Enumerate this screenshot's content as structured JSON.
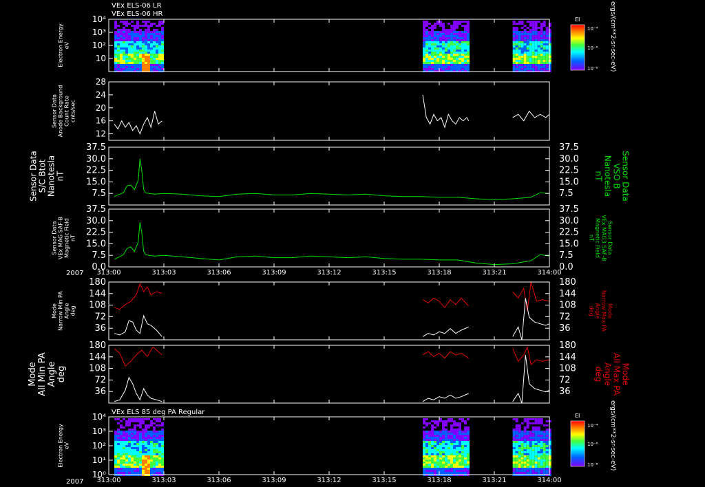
{
  "header": {
    "line1": "VEx ELS-06 LR",
    "line2": "VEx ELS-06 HR"
  },
  "year_label": "2007",
  "time_axis": {
    "ticks": [
      "313:00",
      "313:03",
      "313:06",
      "313:09",
      "313:12",
      "313:15",
      "313:18",
      "313:21",
      "314:00"
    ]
  },
  "colorbar": {
    "title": "EI",
    "units": "ergs/(cm**2-sr-sec-eV)",
    "tick_labels": [
      "10⁻⁴",
      "10⁻⁶",
      "10⁻⁸"
    ]
  },
  "colors": {
    "white": "#ffffff",
    "green": "#00e000",
    "red": "#e00000",
    "background": "#000000"
  },
  "chart_data": [
    {
      "type": "heatmap",
      "id": "panel1",
      "ylabel": [
        "Electron Energy",
        "eV"
      ],
      "y_log": true,
      "ylim": [
        1,
        10000
      ],
      "yticks": [
        "10⁴",
        "10³",
        "10²",
        "10"
      ],
      "data_intervals": [
        [
          "313:00.3",
          "313:02.9"
        ],
        [
          "313:17.1",
          "313:19.6"
        ],
        [
          "313:22.0",
          "313:24.0"
        ]
      ],
      "colorbar": true
    },
    {
      "type": "line",
      "id": "panel2",
      "ylabel": [
        "Sensor Data",
        "Anode Background",
        "Count Rate",
        "cnts/sec"
      ],
      "ylim": [
        10,
        28
      ],
      "yticks": [
        "28",
        "24",
        "20",
        "16",
        "12"
      ],
      "series": [
        {
          "color": "white",
          "segments": [
            {
              "x": [
                0.3,
                0.5,
                0.7,
                0.9,
                1.1,
                1.3,
                1.5,
                1.7,
                1.9,
                2.1,
                2.3,
                2.5,
                2.7,
                2.9
              ],
              "y": [
                15,
                13.5,
                16,
                14,
                15.5,
                13,
                14.5,
                12,
                15,
                17,
                14,
                19,
                15,
                16
              ]
            },
            {
              "x": [
                17.1,
                17.3,
                17.5,
                17.7,
                17.9,
                18.1,
                18.3,
                18.5,
                18.7,
                18.9,
                19.1,
                19.3,
                19.5,
                19.6
              ],
              "y": [
                24,
                17,
                15,
                18,
                16,
                17,
                14,
                18,
                16,
                15,
                17,
                16,
                17,
                16
              ]
            },
            {
              "x": [
                22.0,
                22.3,
                22.6,
                22.9,
                23.2,
                23.5,
                23.8,
                24.0
              ],
              "y": [
                17,
                18,
                16,
                19,
                17,
                18,
                17,
                18
              ]
            }
          ]
        }
      ]
    },
    {
      "type": "line",
      "id": "panel3",
      "ylabel": [
        "Sensor Data",
        "S/C Btot",
        "Nanotesla",
        "nT"
      ],
      "ylabel_right": [
        "Sensor Data",
        "VSO B",
        "Nanotesla",
        "nT"
      ],
      "ylim": [
        0,
        37.5
      ],
      "yticks": [
        "37.5",
        "30.0",
        "22.5",
        "15.0",
        "7.5"
      ],
      "series": [
        {
          "color": "green",
          "segments": [
            {
              "x": [
                0.3,
                0.5,
                0.8,
                1.0,
                1.2,
                1.4,
                1.6,
                1.7,
                1.8,
                1.9,
                2.0,
                2.2,
                2.5,
                3.0,
                4.0,
                5.0,
                6.0,
                7.0,
                8.0,
                9.0,
                10.0,
                11.0,
                12.0,
                13.0,
                14.0,
                15.0,
                16.0,
                17.0,
                18.0,
                19.0,
                20.0,
                21.0,
                22.0,
                23.0,
                23.5,
                24.0
              ],
              "y": [
                5.5,
                6.5,
                8.0,
                12.5,
                13.0,
                10.0,
                16.0,
                30.0,
                22.0,
                10.0,
                8.0,
                7.5,
                7.0,
                7.5,
                7.0,
                6.0,
                5.5,
                7.0,
                7.5,
                6.5,
                6.5,
                7.5,
                7.0,
                6.5,
                7.0,
                6.0,
                5.5,
                5.5,
                5.0,
                5.0,
                4.0,
                3.5,
                4.0,
                5.0,
                8.0,
                7.5
              ]
            }
          ]
        }
      ]
    },
    {
      "type": "line",
      "id": "panel4",
      "ylabel": [
        "Sensor Data",
        "VEx MAG SAF-B",
        "Magnetic Field",
        "nT"
      ],
      "ylabel_right": [
        "Sensor Data",
        "VEx MAG3 SAF-B",
        "Magnetic Field",
        "nT"
      ],
      "ylim": [
        0,
        37.5
      ],
      "yticks": [
        "37.5",
        "30.0",
        "22.5",
        "15.0",
        "7.5",
        "0.0"
      ],
      "series": [
        {
          "color": "green",
          "segments": [
            {
              "x": [
                0.3,
                0.5,
                0.8,
                1.0,
                1.2,
                1.4,
                1.6,
                1.7,
                1.8,
                1.9,
                2.0,
                2.2,
                2.5,
                3.0,
                4.0,
                5.0,
                6.0,
                7.0,
                8.0,
                9.0,
                10.0,
                11.0,
                12.0,
                13.0,
                14.0,
                15.0,
                16.0,
                17.0,
                18.0,
                19.0,
                20.0,
                21.0,
                22.0,
                23.0,
                23.5,
                24.0
              ],
              "y": [
                5.0,
                6.0,
                8.0,
                12.0,
                13.0,
                10.0,
                16.0,
                29.0,
                22.0,
                10.0,
                8.0,
                7.5,
                7.0,
                7.5,
                6.5,
                5.5,
                4.5,
                6.5,
                7.0,
                6.0,
                6.0,
                7.0,
                6.5,
                6.0,
                6.5,
                5.5,
                5.0,
                5.0,
                4.5,
                4.5,
                2.5,
                1.5,
                2.0,
                4.0,
                8.0,
                7.0
              ]
            }
          ]
        }
      ]
    },
    {
      "type": "line",
      "id": "panel5",
      "ylabel": [
        "Mode",
        "Narrow Min PA",
        "Angle",
        "deg"
      ],
      "ylabel_right": [
        "Mode",
        "Narrow Max PA",
        "Angle",
        "deg"
      ],
      "ylim": [
        0,
        180
      ],
      "yticks": [
        "180",
        "144",
        "108",
        "72",
        "36"
      ],
      "series": [
        {
          "color": "red",
          "segments": [
            {
              "x": [
                0.3,
                0.6,
                0.9,
                1.2,
                1.5,
                1.7,
                1.9,
                2.1,
                2.3,
                2.6,
                2.9
              ],
              "y": [
                100,
                95,
                110,
                120,
                140,
                175,
                150,
                165,
                140,
                150,
                145
              ]
            },
            {
              "x": [
                17.1,
                17.4,
                17.7,
                18.0,
                18.3,
                18.6,
                18.9,
                19.2,
                19.6
              ],
              "y": [
                125,
                115,
                130,
                120,
                100,
                125,
                110,
                130,
                105
              ]
            },
            {
              "x": [
                22.0,
                22.3,
                22.6,
                22.8,
                23.0,
                23.3,
                23.6,
                24.0
              ],
              "y": [
                150,
                130,
                160,
                90,
                180,
                120,
                125,
                120
              ]
            }
          ]
        },
        {
          "color": "white",
          "segments": [
            {
              "x": [
                0.3,
                0.6,
                0.9,
                1.1,
                1.3,
                1.5,
                1.7,
                1.9,
                2.1,
                2.3,
                2.6,
                2.9
              ],
              "y": [
                20,
                15,
                25,
                60,
                55,
                30,
                20,
                75,
                50,
                45,
                30,
                10
              ]
            },
            {
              "x": [
                17.1,
                17.4,
                17.7,
                18.0,
                18.3,
                18.6,
                18.9,
                19.2,
                19.6
              ],
              "y": [
                10,
                20,
                15,
                25,
                20,
                35,
                20,
                30,
                40
              ]
            },
            {
              "x": [
                22.0,
                22.3,
                22.5,
                22.7,
                22.9,
                23.2,
                23.5,
                23.8,
                24.0
              ],
              "y": [
                10,
                40,
                0,
                130,
                70,
                55,
                50,
                45,
                50
              ]
            }
          ]
        }
      ]
    },
    {
      "type": "line",
      "id": "panel6",
      "ylabel": [
        "Mode",
        "All Min PA",
        "Angle",
        "deg"
      ],
      "ylabel_right": [
        "Mode",
        "All Max PA",
        "Angle",
        "deg"
      ],
      "ylim": [
        0,
        180
      ],
      "yticks": [
        "180",
        "144",
        "108",
        "72",
        "36"
      ],
      "series": [
        {
          "color": "red",
          "segments": [
            {
              "x": [
                0.3,
                0.6,
                0.9,
                1.2,
                1.5,
                1.8,
                2.1,
                2.4,
                2.7,
                2.9
              ],
              "y": [
                170,
                155,
                115,
                130,
                150,
                165,
                145,
                175,
                160,
                150
              ]
            },
            {
              "x": [
                17.1,
                17.4,
                17.7,
                18.0,
                18.3,
                18.6,
                18.9,
                19.2,
                19.6
              ],
              "y": [
                150,
                160,
                145,
                155,
                140,
                160,
                150,
                155,
                140
              ]
            },
            {
              "x": [
                22.0,
                22.3,
                22.6,
                22.8,
                23.0,
                23.3,
                23.6,
                24.0
              ],
              "y": [
                170,
                130,
                150,
                175,
                120,
                135,
                130,
                135
              ]
            }
          ]
        },
        {
          "color": "white",
          "segments": [
            {
              "x": [
                0.3,
                0.6,
                0.9,
                1.1,
                1.3,
                1.5,
                1.7,
                1.9,
                2.1,
                2.3,
                2.6,
                2.9
              ],
              "y": [
                5,
                10,
                40,
                80,
                60,
                30,
                10,
                45,
                25,
                15,
                10,
                5
              ]
            },
            {
              "x": [
                17.1,
                17.4,
                17.7,
                18.0,
                18.3,
                18.6,
                18.9,
                19.2,
                19.6
              ],
              "y": [
                5,
                15,
                10,
                20,
                15,
                25,
                15,
                20,
                30
              ]
            },
            {
              "x": [
                22.0,
                22.3,
                22.5,
                22.7,
                22.9,
                23.2,
                23.5,
                23.8,
                24.0
              ],
              "y": [
                5,
                30,
                0,
                150,
                60,
                45,
                40,
                35,
                40
              ]
            }
          ]
        }
      ]
    },
    {
      "type": "heatmap",
      "id": "panel7",
      "title": "VEx ELS 85 deg PA Regular",
      "ylabel": [
        "Electron Energy",
        "eV"
      ],
      "y_log": true,
      "ylim": [
        1,
        10000
      ],
      "yticks": [
        "10⁴",
        "10³",
        "10²",
        "10¹",
        "10⁰"
      ],
      "data_intervals": [
        [
          "313:00.3",
          "313:02.9"
        ],
        [
          "313:17.1",
          "313:19.6"
        ],
        [
          "313:22.0",
          "313:24.0"
        ]
      ],
      "colorbar": true
    }
  ]
}
